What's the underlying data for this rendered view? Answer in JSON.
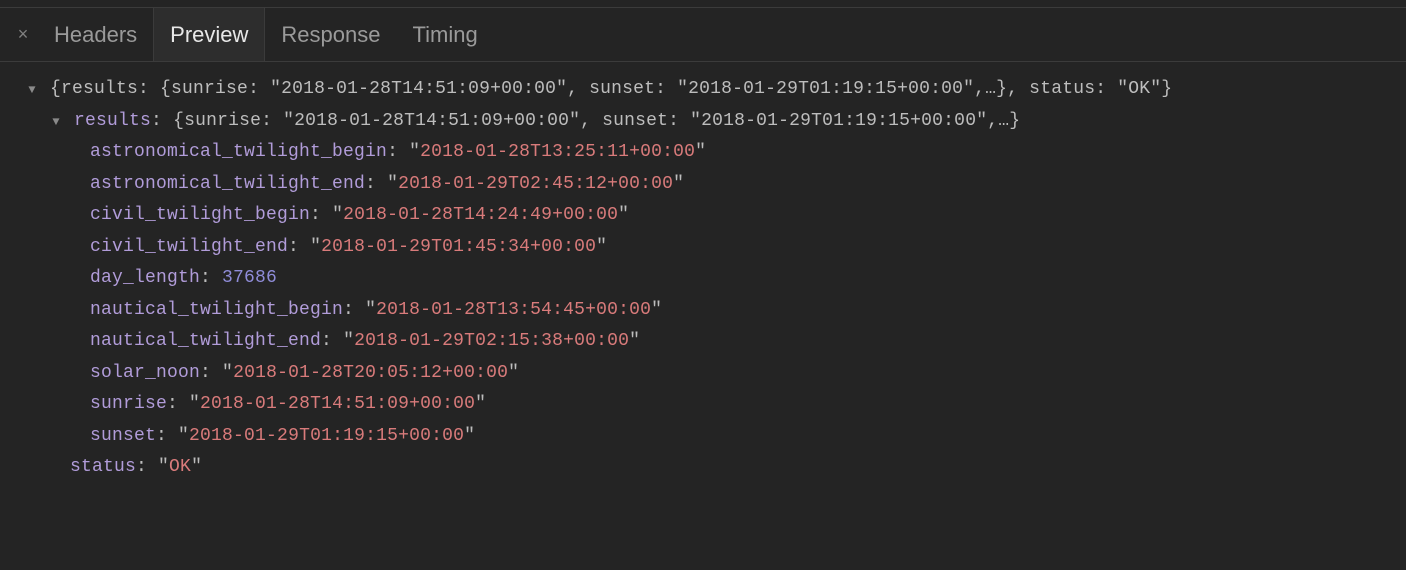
{
  "tabs": {
    "close_glyph": "×",
    "headers": "Headers",
    "preview": "Preview",
    "response": "Response",
    "timing": "Timing"
  },
  "tree": {
    "arrow_glyph": "▼",
    "root_summary": "{results: {sunrise: \"2018-01-28T14:51:09+00:00\", sunset: \"2018-01-29T01:19:15+00:00\",…}, status: \"OK\"}",
    "results_key": "results",
    "results_summary": "{sunrise: \"2018-01-28T14:51:09+00:00\", sunset: \"2018-01-29T01:19:15+00:00\",…}",
    "status_key": "status",
    "status_value": "OK",
    "props": {
      "astronomical_twilight_begin": {
        "key": "astronomical_twilight_begin",
        "value": "2018-01-28T13:25:11+00:00"
      },
      "astronomical_twilight_end": {
        "key": "astronomical_twilight_end",
        "value": "2018-01-29T02:45:12+00:00"
      },
      "civil_twilight_begin": {
        "key": "civil_twilight_begin",
        "value": "2018-01-28T14:24:49+00:00"
      },
      "civil_twilight_end": {
        "key": "civil_twilight_end",
        "value": "2018-01-29T01:45:34+00:00"
      },
      "day_length": {
        "key": "day_length",
        "value": "37686"
      },
      "nautical_twilight_begin": {
        "key": "nautical_twilight_begin",
        "value": "2018-01-28T13:54:45+00:00"
      },
      "nautical_twilight_end": {
        "key": "nautical_twilight_end",
        "value": "2018-01-29T02:15:38+00:00"
      },
      "solar_noon": {
        "key": "solar_noon",
        "value": "2018-01-28T20:05:12+00:00"
      },
      "sunrise": {
        "key": "sunrise",
        "value": "2018-01-28T14:51:09+00:00"
      },
      "sunset": {
        "key": "sunset",
        "value": "2018-01-29T01:19:15+00:00"
      }
    }
  }
}
